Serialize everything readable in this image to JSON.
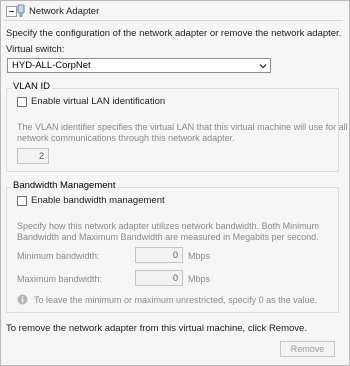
{
  "header": {
    "title": "Network Adapter"
  },
  "description": "Specify the configuration of the network adapter or remove the network adapter.",
  "virtual_switch": {
    "label": "Virtual switch:",
    "value": "HYD-ALL-CorpNet"
  },
  "vlan": {
    "group_title": "VLAN ID",
    "checkbox_label": "Enable virtual LAN identification",
    "help_line1": "The VLAN identifier specifies the virtual LAN that this virtual machine will use for all",
    "help_line2": "network communications through this network adapter.",
    "value": "2"
  },
  "bandwidth": {
    "group_title": "Bandwidth Management",
    "checkbox_label": "Enable bandwidth management",
    "help_line1": "Specify how this network adapter utilizes network bandwidth. Both Minimum",
    "help_line2": "Bandwidth and Maximum Bandwidth are measured in Megabits per second.",
    "min_label": "Minimum bandwidth:",
    "min_value": "0",
    "max_label": "Maximum bandwidth:",
    "max_value": "0",
    "unit": "Mbps",
    "info_text": "To leave the minimum or maximum unrestricted, specify 0 as the value."
  },
  "remove": {
    "instruction": "To remove the network adapter from this virtual machine, click Remove.",
    "button_label": "Remove"
  },
  "icons": {
    "collapse": "collapse-icon",
    "adapter": "network-adapter-icon",
    "info": "info-icon",
    "dropdown": "chevron-down-icon"
  }
}
